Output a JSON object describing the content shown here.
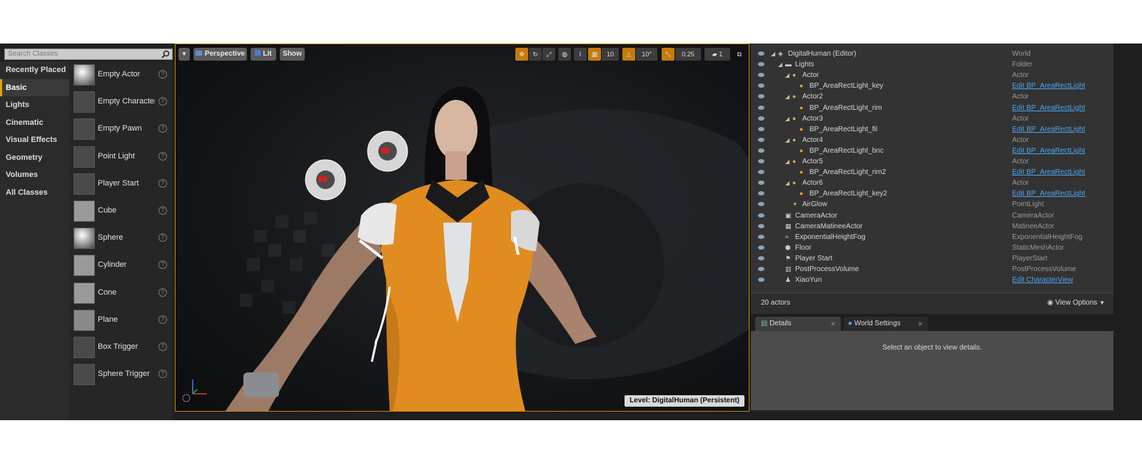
{
  "place_actors": {
    "search_placeholder": "Search Classes",
    "categories": [
      "Recently Placed",
      "Basic",
      "Lights",
      "Cinematic",
      "Visual Effects",
      "Geometry",
      "Volumes",
      "All Classes"
    ],
    "active_category": "Basic",
    "items": [
      {
        "label": "Empty Actor",
        "icon": "sphere-icon"
      },
      {
        "label": "Empty Character",
        "icon": "character-icon"
      },
      {
        "label": "Empty Pawn",
        "icon": "pawn-icon"
      },
      {
        "label": "Point Light",
        "icon": "light-bulb-icon"
      },
      {
        "label": "Player Start",
        "icon": "player-start-icon"
      },
      {
        "label": "Cube",
        "icon": "cube-icon"
      },
      {
        "label": "Sphere",
        "icon": "sphere-icon"
      },
      {
        "label": "Cylinder",
        "icon": "cylinder-icon"
      },
      {
        "label": "Cone",
        "icon": "cone-icon"
      },
      {
        "label": "Plane",
        "icon": "plane-icon"
      },
      {
        "label": "Box Trigger",
        "icon": "box-trigger-icon"
      },
      {
        "label": "Sphere Trigger",
        "icon": "sphere-trigger-icon"
      }
    ]
  },
  "viewport": {
    "menu_label": "",
    "perspective_label": "Perspective",
    "lit_label": "Lit",
    "show_label": "Show",
    "grid_snap": "10",
    "rotation_snap": "10°",
    "scale_snap": "0.25",
    "camera_speed": "1",
    "level_label": "Level:  DigitalHuman (Persistent)",
    "accent_color": "#c67a0a"
  },
  "outliner": {
    "rows": [
      {
        "name": "DigitalHuman (Editor)",
        "type": "World",
        "indent": 0,
        "expand": true,
        "icon": "world-icon",
        "link": false
      },
      {
        "name": "Lights",
        "type": "Folder",
        "indent": 1,
        "expand": true,
        "icon": "folder-icon",
        "link": false
      },
      {
        "name": "Actor",
        "type": "Actor",
        "indent": 2,
        "expand": true,
        "icon": "actor-icon",
        "link": false
      },
      {
        "name": "BP_AreaRectLight_key",
        "type": "Edit BP_AreaRectLight",
        "indent": 3,
        "expand": false,
        "icon": "actor-icon",
        "link": true
      },
      {
        "name": "Actor2",
        "type": "Actor",
        "indent": 2,
        "expand": true,
        "icon": "actor-icon",
        "link": false
      },
      {
        "name": "BP_AreaRectLight_rim",
        "type": "Edit BP_AreaRectLight",
        "indent": 3,
        "expand": false,
        "icon": "actor-icon",
        "link": true
      },
      {
        "name": "Actor3",
        "type": "Actor",
        "indent": 2,
        "expand": true,
        "icon": "actor-icon",
        "link": false
      },
      {
        "name": "BP_AreaRectLight_fil",
        "type": "Edit BP_AreaRectLight",
        "indent": 3,
        "expand": false,
        "icon": "actor-icon",
        "link": true
      },
      {
        "name": "Actor4",
        "type": "Actor",
        "indent": 2,
        "expand": true,
        "icon": "actor-icon",
        "link": false
      },
      {
        "name": "BP_AreaRectLight_bnc",
        "type": "Edit BP_AreaRectLight",
        "indent": 3,
        "expand": false,
        "icon": "actor-icon",
        "link": true
      },
      {
        "name": "Actor5",
        "type": "Actor",
        "indent": 2,
        "expand": true,
        "icon": "actor-icon",
        "link": false
      },
      {
        "name": "BP_AreaRectLight_rim2",
        "type": "Edit BP_AreaRectLight",
        "indent": 3,
        "expand": false,
        "icon": "actor-icon",
        "link": true
      },
      {
        "name": "Actor6",
        "type": "Actor",
        "indent": 2,
        "expand": true,
        "icon": "actor-icon",
        "link": false
      },
      {
        "name": "BP_AreaRectLight_key2",
        "type": "Edit BP_AreaRectLight",
        "indent": 3,
        "expand": false,
        "icon": "actor-icon",
        "link": true
      },
      {
        "name": "AirGlow",
        "type": "PointLight",
        "indent": 2,
        "expand": false,
        "icon": "light-bulb-icon",
        "link": false
      },
      {
        "name": "CameraActor",
        "type": "CameraActor",
        "indent": 1,
        "expand": false,
        "icon": "camera-icon",
        "link": false
      },
      {
        "name": "CameraMatineeActor",
        "type": "MatineeActor",
        "indent": 1,
        "expand": false,
        "icon": "matinee-icon",
        "link": false
      },
      {
        "name": "ExponentialHeightFog",
        "type": "ExponentialHeightFog",
        "indent": 1,
        "expand": false,
        "icon": "fog-icon",
        "link": false
      },
      {
        "name": "Floor",
        "type": "StaticMeshActor",
        "indent": 1,
        "expand": false,
        "icon": "mesh-icon",
        "link": false
      },
      {
        "name": "Player Start",
        "type": "PlayerStart",
        "indent": 1,
        "expand": false,
        "icon": "player-start-icon",
        "link": false
      },
      {
        "name": "PostProcessVolume",
        "type": "PostProcessVolume",
        "indent": 1,
        "expand": false,
        "icon": "volume-icon",
        "link": false
      },
      {
        "name": "XiaoYun",
        "type": "Edit CharacterView",
        "indent": 1,
        "expand": false,
        "icon": "character-icon",
        "link": true
      }
    ],
    "actor_count": "20 actors",
    "view_options": "View Options"
  },
  "details": {
    "tabs": [
      "Details",
      "World Settings"
    ],
    "empty_message": "Select an object to view details."
  }
}
